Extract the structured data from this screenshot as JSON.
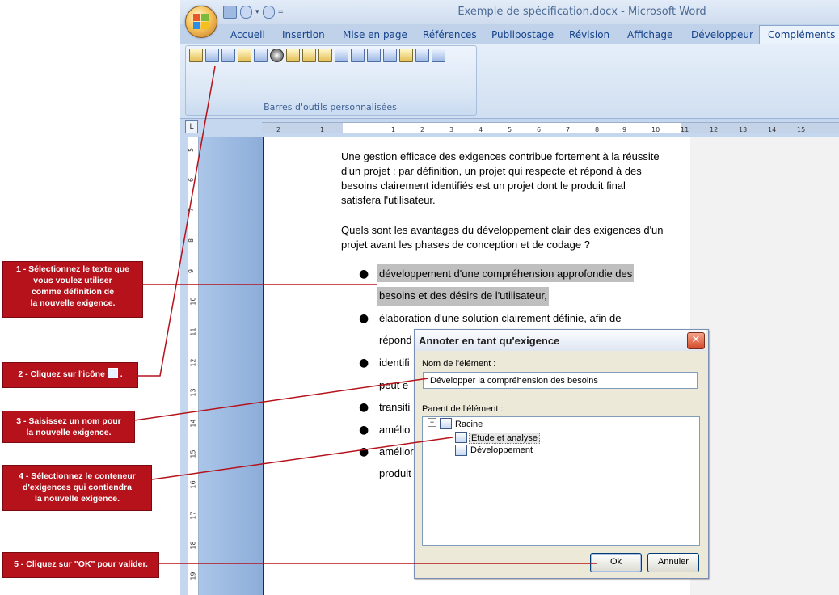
{
  "window": {
    "title": "Exemple de spécification.docx - Microsoft Word",
    "qat_dropdown": "▾",
    "qat_sep": "="
  },
  "ribbon": {
    "tabs": [
      "Accueil",
      "Insertion",
      "Mise en page",
      "Références",
      "Publipostage",
      "Révision",
      "Affichage",
      "Développeur",
      "Compléments"
    ],
    "active_tab": "Compléments",
    "group_label": "Barres d'outils personnalisées"
  },
  "rulers": {
    "corner": "L",
    "horizontal_ticks": [
      "2",
      "1",
      "1",
      "2",
      "3",
      "4",
      "5",
      "6",
      "7",
      "8",
      "9",
      "10",
      "11",
      "12",
      "13",
      "14",
      "15"
    ],
    "vertical_ticks": [
      "5",
      "6",
      "7",
      "8",
      "9",
      "10",
      "11",
      "12",
      "13",
      "14",
      "15",
      "16",
      "17",
      "18",
      "19"
    ]
  },
  "document": {
    "paragraph1": [
      "Une gestion efficace des exigences contribue fortement à la réussite",
      "d'un projet :  par définition, un projet qui respecte et répond à des",
      "besoins clairement identifiés est un projet dont le produit final",
      "satisfera l'utilisateur."
    ],
    "paragraph2": [
      "Quels sont les avantages du développement clair des exigences d'un",
      "projet avant les phases de conception et de codage ?"
    ],
    "bullets": [
      "développement d'une compréhension approfondie des",
      "besoins et des désirs de l'utilisateur,",
      "élaboration d'une solution clairement définie, afin de",
      "répond",
      "identifi",
      "peut ê",
      "transiti",
      "amélio",
      "améliora",
      "produit"
    ]
  },
  "callouts": [
    "1 - Sélectionnez le texte que vous voulez utiliser comme définition de la nouvelle exigence.",
    "2 - Cliquez sur l'icône",
    "3 - Saisissez un nom pour la nouvelle exigence.",
    "4 - Sélectionnez le conteneur d'exigences qui contiendra la nouvelle exigence.",
    "5 - Cliquez sur \"OK\" pour valider."
  ],
  "callout_lines": {
    "c1": [
      "1 - Sélectionnez le texte que",
      "vous voulez utiliser",
      "comme définition de",
      "la nouvelle exigence."
    ],
    "c2_suffix": ".",
    "c3": [
      "3 - Saisissez un nom pour",
      "la nouvelle exigence."
    ],
    "c4": [
      "4 - Sélectionnez le conteneur",
      "d'exigences qui contiendra",
      "la nouvelle exigence."
    ]
  },
  "dialog": {
    "title": "Annoter en tant qu'exigence",
    "close": "✕",
    "name_label": "Nom de l'élément :",
    "name_value": "Développer la compréhension des besoins",
    "parent_label": "Parent de l'élément :",
    "tree": {
      "root": "Racine",
      "root_toggle": "−",
      "children": [
        "Etude et analyse",
        "Développement"
      ],
      "selected": "Etude et analyse"
    },
    "ok": "Ok",
    "cancel": "Annuler"
  },
  "colors": {
    "callout_red": "#b5121b",
    "ribbon_text": "#15428b",
    "highlight_gray": "#bfbfbf"
  }
}
